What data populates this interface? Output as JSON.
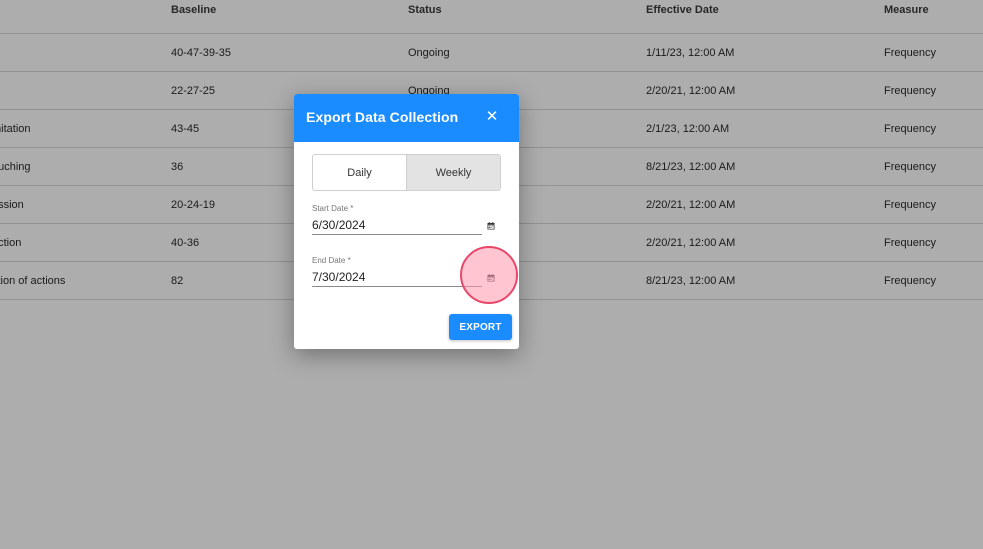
{
  "table": {
    "headers": {
      "baseline": "Baseline",
      "status": "Status",
      "effective_date": "Effective Date",
      "measure": "Measure"
    },
    "rows": [
      {
        "name": "",
        "baseline": "40-47-39-35",
        "status": "Ongoing",
        "effective_date": "1/11/23, 12:00 AM",
        "measure": "Frequency"
      },
      {
        "name": "",
        "baseline": "22-27-25",
        "status": "Ongoing",
        "effective_date": "2/20/21, 12:00 AM",
        "measure": "Frequency"
      },
      {
        "name": "mitation",
        "baseline": "43-45",
        "status": "",
        "effective_date": "2/1/23, 12:00 AM",
        "measure": "Frequency"
      },
      {
        "name": "ouching",
        "baseline": "36",
        "status": "",
        "effective_date": "8/21/23, 12:00 AM",
        "measure": "Frequency"
      },
      {
        "name": "ession",
        "baseline": "20-24-19",
        "status": "",
        "effective_date": "2/20/21, 12:00 AM",
        "measure": "Frequency"
      },
      {
        "name": "uction",
        "baseline": "40-36",
        "status": "",
        "effective_date": "2/20/21, 12:00 AM",
        "measure": "Frequency"
      },
      {
        "name": "tition of actions",
        "baseline": "82",
        "status": "",
        "effective_date": "8/21/23, 12:00 AM",
        "measure": "Frequency"
      }
    ]
  },
  "dialog": {
    "title": "Export Data Collection",
    "close_glyph": "✕",
    "toggle": {
      "daily": "Daily",
      "weekly": "Weekly",
      "selected": "weekly"
    },
    "start_date": {
      "label": "Start Date *",
      "value": "6/30/2024"
    },
    "end_date": {
      "label": "End Date *",
      "value": "7/30/2024"
    },
    "export_label": "EXPORT"
  },
  "colors": {
    "primary": "#1a8cff",
    "click_indicator": "#e8476a"
  },
  "icons": {
    "close": "close-icon",
    "calendar": "calendar-icon"
  }
}
